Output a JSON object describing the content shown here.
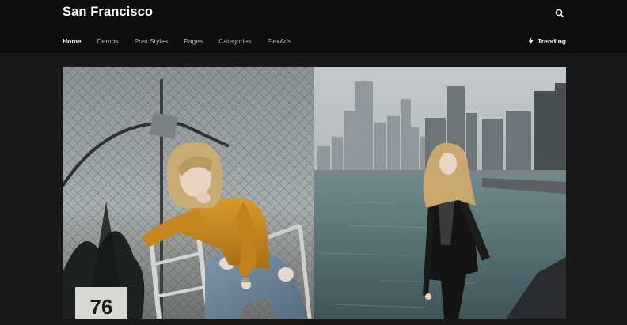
{
  "site": {
    "title": "San Francisco"
  },
  "header": {
    "search_icon": "search-icon"
  },
  "nav": {
    "items": [
      {
        "label": "Home",
        "active": true
      },
      {
        "label": "Demos",
        "active": false
      },
      {
        "label": "Post Styles",
        "active": false
      },
      {
        "label": "Pages",
        "active": false
      },
      {
        "label": "Categories",
        "active": false
      },
      {
        "label": "FlexAds",
        "active": false
      }
    ],
    "trending_label": "Trending",
    "trending_icon": "lightning-bolt-icon"
  },
  "hero": {
    "sign_number": "76"
  },
  "colors": {
    "background": "#181818",
    "header": "#0e0e0e",
    "text": "#ffffff",
    "nav_text": "#b9b9b9"
  }
}
